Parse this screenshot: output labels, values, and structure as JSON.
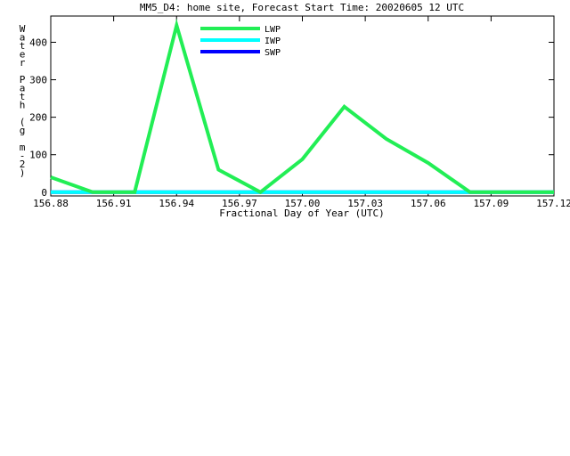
{
  "chart_data": {
    "type": "line",
    "title": "MM5_D4: home site,  Forecast Start Time: 20020605 12 UTC",
    "xlabel": "Fractional Day of Year (UTC)",
    "ylabel": "Water Path (g m-2)",
    "xlim": [
      156.88,
      157.12
    ],
    "ylim": [
      -10,
      470
    ],
    "x_ticks": [
      156.88,
      156.91,
      156.94,
      156.97,
      157.0,
      157.03,
      157.06,
      157.09,
      157.12
    ],
    "x_tick_labels": [
      "156.88",
      "156.91",
      "156.94",
      "156.97",
      "157.00",
      "157.03",
      "157.06",
      "157.09",
      "157.12"
    ],
    "y_ticks": [
      0,
      100,
      200,
      300,
      400
    ],
    "y_tick_labels": [
      "0",
      "100",
      "200",
      "300",
      "400"
    ],
    "grid": false,
    "legend_position": "top-left",
    "series": [
      {
        "name": "LWP",
        "color": "#22ee55",
        "x": [
          156.88,
          156.9,
          156.92,
          156.94,
          156.96,
          156.98,
          157.0,
          157.02,
          157.04,
          157.06,
          157.08,
          157.1,
          157.12
        ],
        "y": [
          40,
          0,
          0,
          445,
          60,
          0,
          88,
          228,
          142,
          78,
          0,
          0,
          0
        ]
      },
      {
        "name": "IWP",
        "color": "#00ffff",
        "x": [
          156.88,
          157.12
        ],
        "y": [
          0,
          0
        ]
      },
      {
        "name": "SWP",
        "color": "#0000ff",
        "x": [
          156.88,
          157.12
        ],
        "y": [
          0,
          0
        ]
      }
    ]
  }
}
